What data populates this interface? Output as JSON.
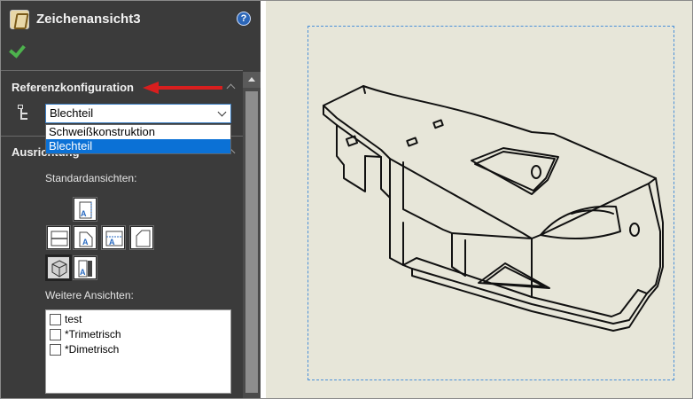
{
  "window": {
    "title": "Zeichenansicht3"
  },
  "sections": {
    "reference": {
      "title": "Referenzkonfiguration",
      "selected": "Blechteil",
      "options": [
        "Schweißkonstruktion",
        "Blechteil"
      ],
      "highlighted_option": "Blechteil"
    },
    "orientation": {
      "title": "Ausrichtung",
      "standard_views_label": "Standardansichten:",
      "more_views_label": "Weitere Ansichten:",
      "more_views": [
        {
          "label": "test",
          "checked": false
        },
        {
          "label": "*Trimetrisch",
          "checked": false
        },
        {
          "label": "*Dimetrisch",
          "checked": false
        }
      ]
    }
  },
  "icons": {
    "app": "drawing-view-icon",
    "help": "help-icon",
    "ok": "checkmark-icon",
    "configuration": "configuration-tree-icon"
  },
  "colors": {
    "panel_bg": "#3b3b3b",
    "accent_blue": "#0b71d6",
    "ok_green": "#4db24d",
    "arrow_red": "#d81e1e",
    "canvas_bg": "#e7e6d9",
    "boundary_blue": "#4a90d9"
  }
}
